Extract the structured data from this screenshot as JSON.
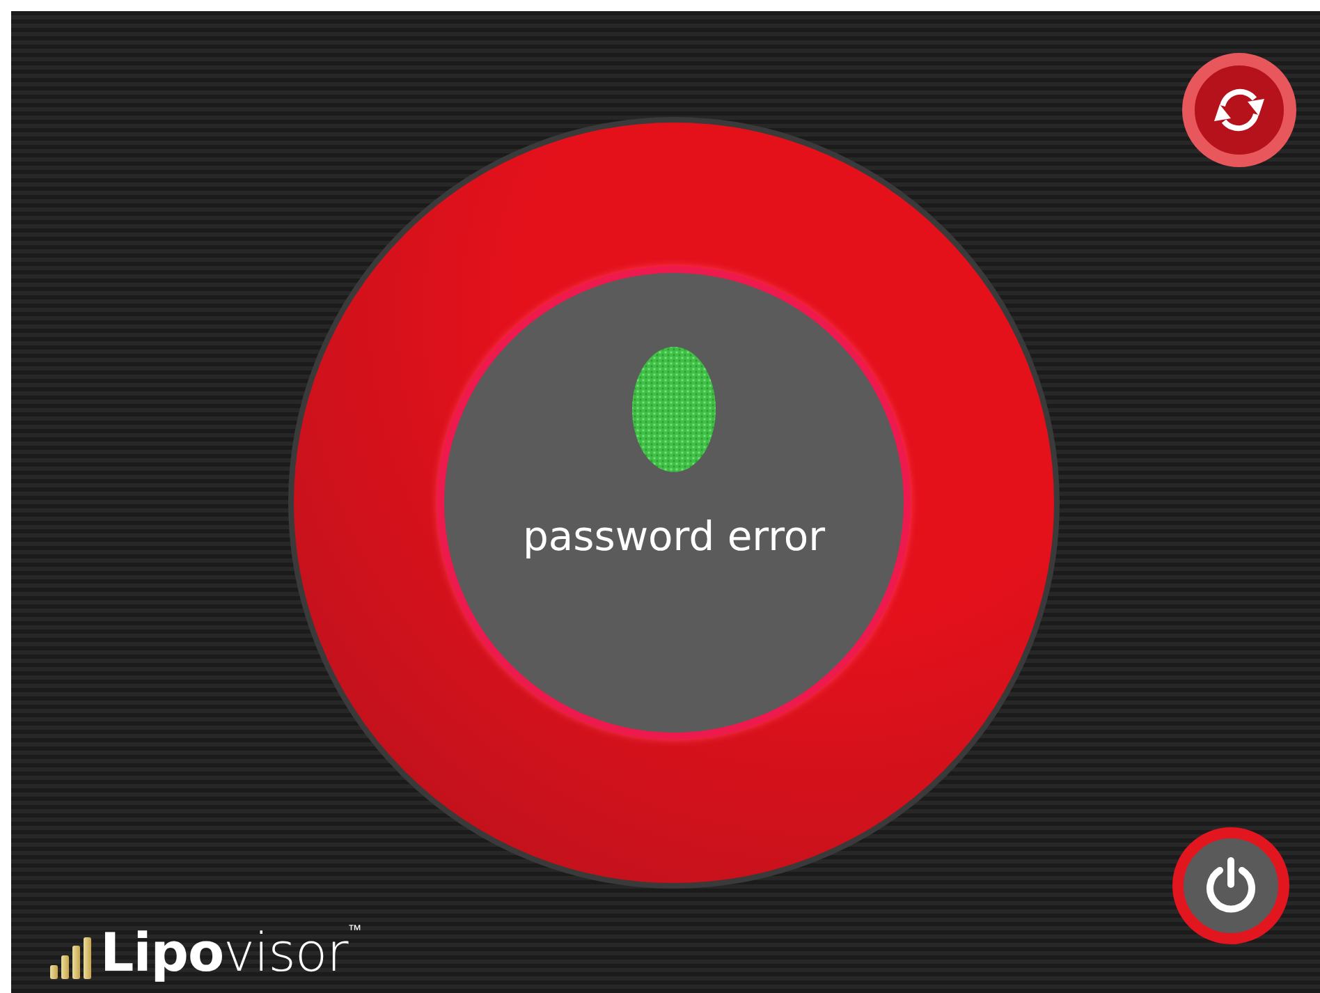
{
  "status": {
    "error": true,
    "message": "password error"
  },
  "logo": {
    "text": "**Lipo**visor$^{™}$"
  }
}
